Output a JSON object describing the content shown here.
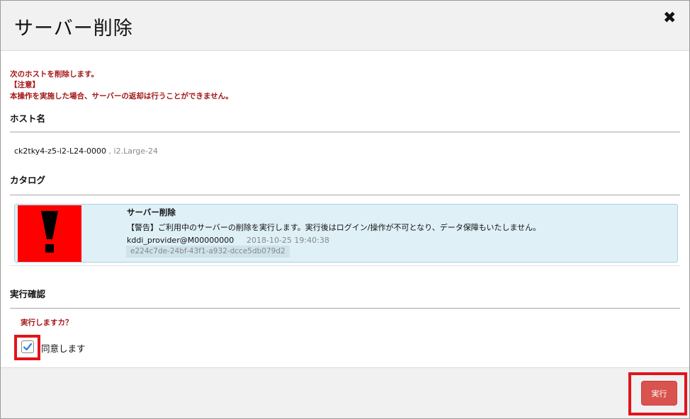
{
  "dialog": {
    "title": "サーバー削除",
    "close_symbol": "✖"
  },
  "warnings": {
    "line1": "次のホストを削除します。",
    "line2": "【注意】",
    "line3": "本操作を実施した場合、サーバーの返却は行うことができません。"
  },
  "host_section": {
    "title": "ホスト名",
    "host_name": "ck2tky4-z5-i2-L24-0000",
    "separator": ",",
    "flavor": "i2.Large-24"
  },
  "catalog_section": {
    "title": "カタログ",
    "item": {
      "name": "サーバー削除",
      "description": "【警告】ご利用中のサーバーの削除を実行します。実行後はログイン/操作が不可となり、データ保障もいたしません。",
      "user": "kddi_provider@M00000000",
      "date": "2018-10-25 19:40:38",
      "id": "e224c7de-24bf-43f1-a932-dcce5db079d2",
      "icon": "exclamation-icon"
    }
  },
  "confirm_section": {
    "title": "実行確認",
    "question": "実行しますカ？",
    "agree_label": "同意します",
    "agree_checked": true
  },
  "footer": {
    "execute_label": "実行"
  },
  "colors": {
    "warning_text": "#a31515",
    "alert_box": "#ff0000",
    "catalog_bg": "#dff0f7",
    "button": "#d9534f",
    "highlight": "#e1141b"
  }
}
